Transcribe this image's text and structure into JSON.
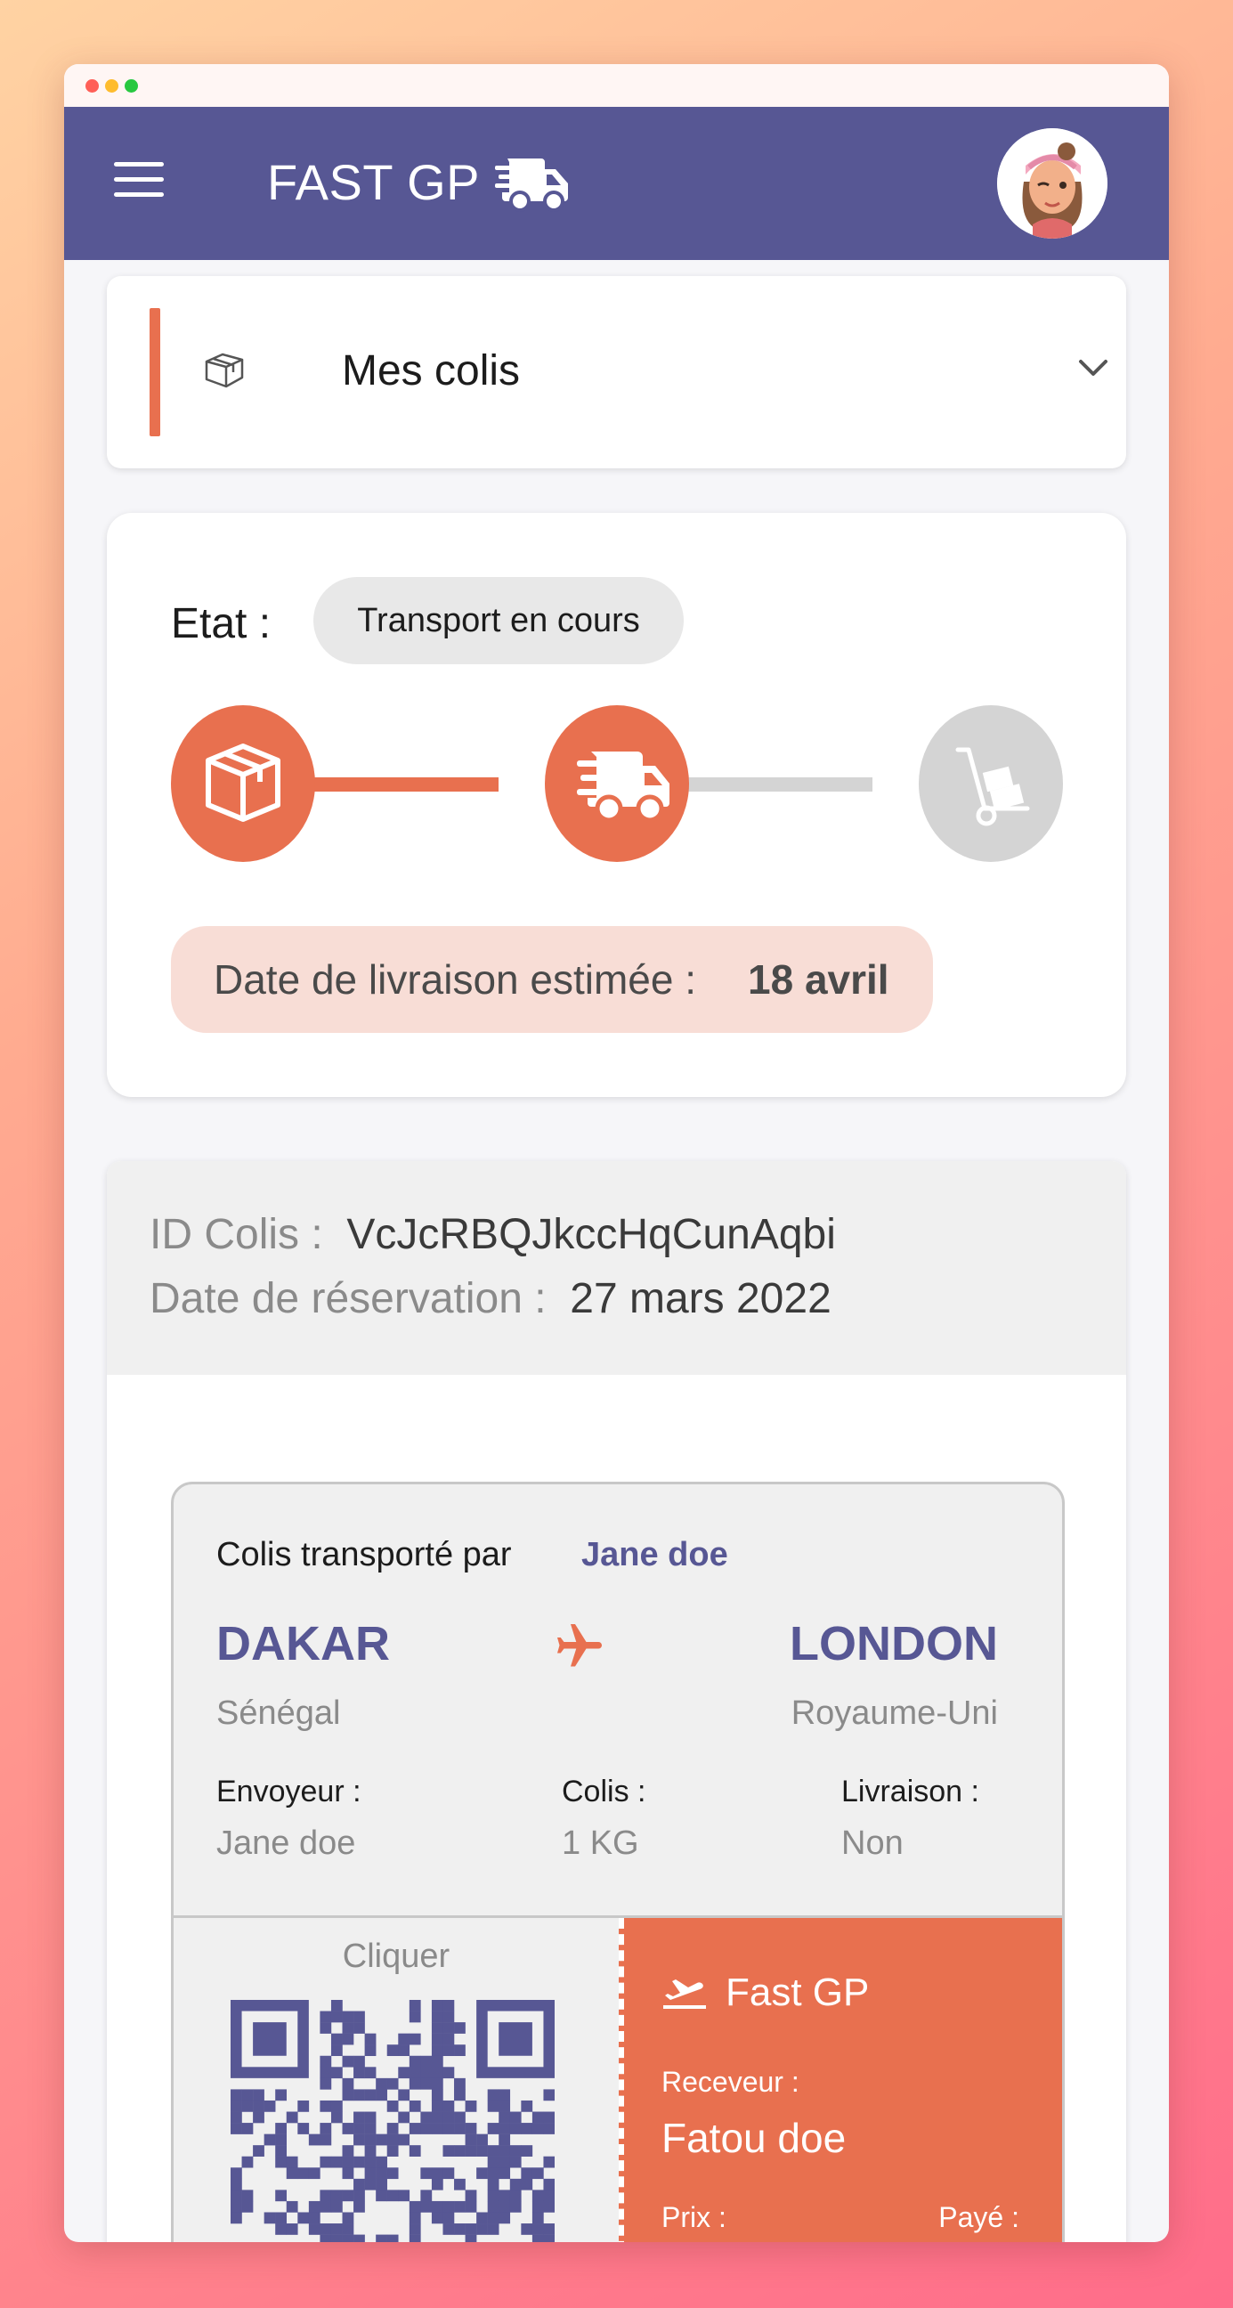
{
  "app": {
    "name": "FAST GP"
  },
  "colors": {
    "primary": "#575794",
    "accent": "#e8704f",
    "pending": "#d4d4d4"
  },
  "dropdown": {
    "title": "Mes colis",
    "icon": "package-outline-icon"
  },
  "status": {
    "label": "Etat :",
    "value": "Transport en cours",
    "steps": [
      {
        "name": "prise-en-charge",
        "icon": "package-icon",
        "done": true
      },
      {
        "name": "transport",
        "icon": "truck-icon",
        "done": true
      },
      {
        "name": "livraison",
        "icon": "hand-truck-icon",
        "done": false
      }
    ],
    "delivery_label": "Date de livraison estimée :",
    "delivery_date": "18 avril"
  },
  "parcel": {
    "id_label": "ID Colis :",
    "id_value": "VcJcRBQJkccHqCunAqbi",
    "reservation_label": "Date de réservation :",
    "reservation_value": "27 mars 2022"
  },
  "ticket": {
    "carrier_label": "Colis transporté par",
    "carrier_name": "Jane doe",
    "origin_city": "DAKAR",
    "origin_country": "Sénégal",
    "destination_city": "LONDON",
    "destination_country": "Royaume-Uni",
    "sender_label": "Envoyeur :",
    "sender_value": "Jane doe",
    "parcel_label": "Colis :",
    "parcel_value": "1 KG",
    "delivery_label": "Livraison :",
    "delivery_value": "Non",
    "qr_caption": "Cliquer",
    "stub_brand": "Fast GP",
    "receiver_label": "Receveur :",
    "receiver_value": "Fatou doe",
    "price_label": "Prix :",
    "paid_label": "Payé :"
  }
}
